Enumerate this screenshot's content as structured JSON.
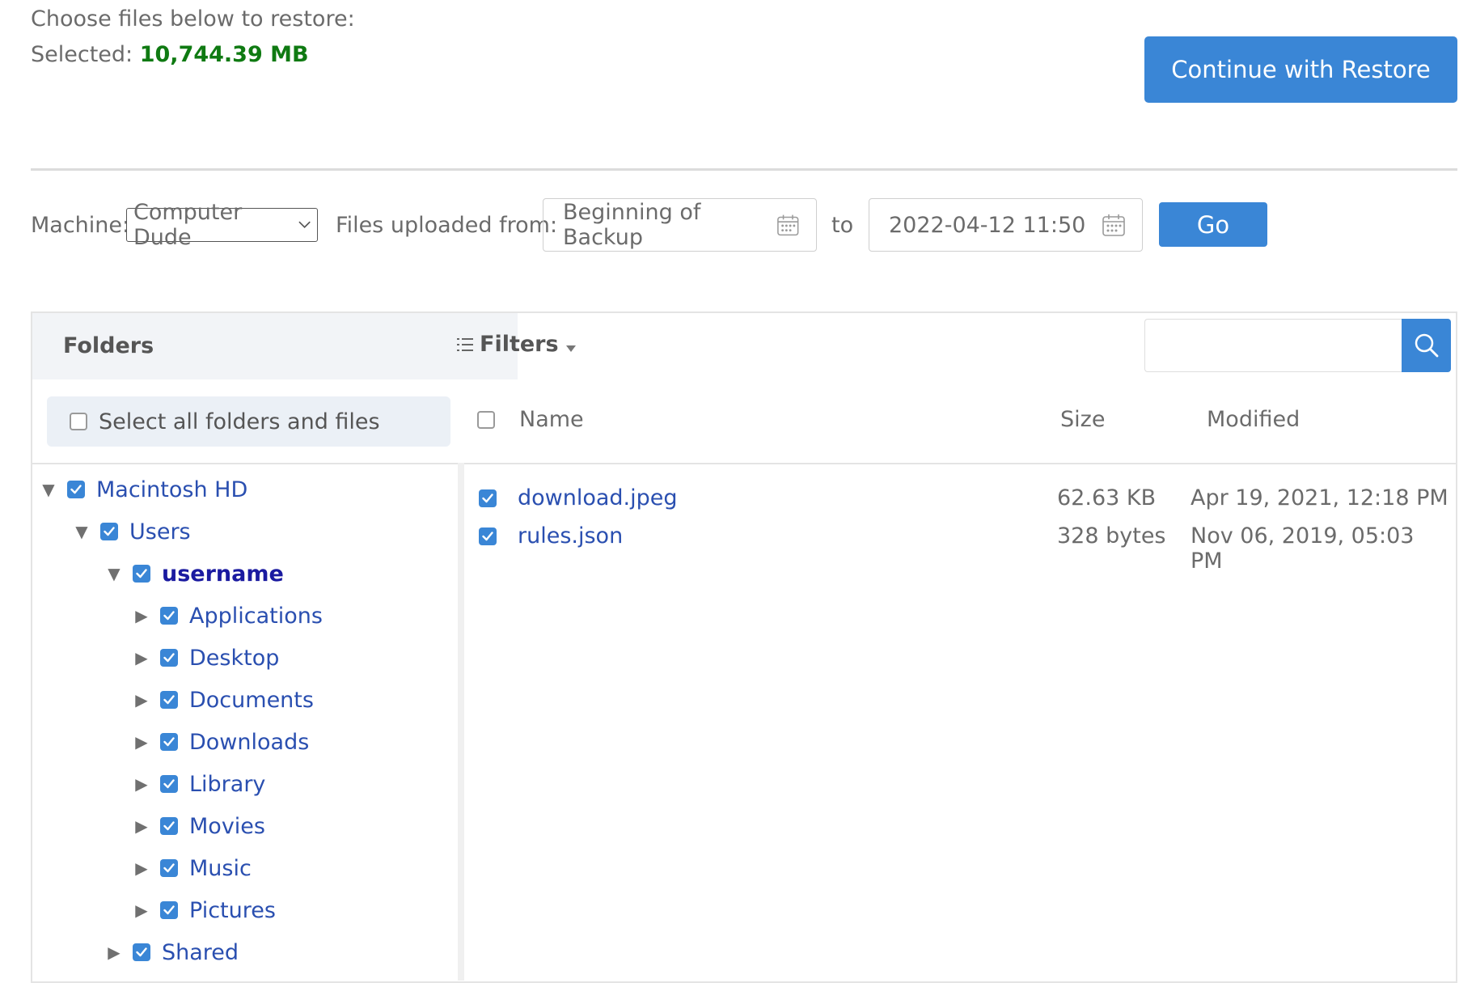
{
  "header": {
    "prompt": "Choose files below to restore:",
    "selected_label": "Selected:",
    "selected_value": "10,744.39 MB",
    "continue_label": "Continue with Restore"
  },
  "filter_bar": {
    "machine_label": "Machine:",
    "machine_value": "Computer Dude",
    "from_label": "Files uploaded from:",
    "from_value": "Beginning of Backup",
    "to_label": "to",
    "to_value": "2022-04-12 11:50",
    "go_label": "Go"
  },
  "panel": {
    "folders_title": "Folders",
    "filters_label": "Filters",
    "search_placeholder": "",
    "select_all_label": "Select all folders and files",
    "columns": {
      "name": "Name",
      "size": "Size",
      "modified": "Modified"
    }
  },
  "tree": [
    {
      "label": "Macintosh HD",
      "expanded": true,
      "checked": true,
      "level": 0
    },
    {
      "label": "Users",
      "expanded": true,
      "checked": true,
      "level": 1
    },
    {
      "label": "username",
      "expanded": true,
      "checked": true,
      "level": 2,
      "bold": true
    },
    {
      "label": "Applications",
      "expanded": false,
      "checked": true,
      "level": 3
    },
    {
      "label": "Desktop",
      "expanded": false,
      "checked": true,
      "level": 3
    },
    {
      "label": "Documents",
      "expanded": false,
      "checked": true,
      "level": 3
    },
    {
      "label": "Downloads",
      "expanded": false,
      "checked": true,
      "level": 3
    },
    {
      "label": "Library",
      "expanded": false,
      "checked": true,
      "level": 3
    },
    {
      "label": "Movies",
      "expanded": false,
      "checked": true,
      "level": 3
    },
    {
      "label": "Music",
      "expanded": false,
      "checked": true,
      "level": 3
    },
    {
      "label": "Pictures",
      "expanded": false,
      "checked": true,
      "level": 3
    },
    {
      "label": "Shared",
      "expanded": false,
      "checked": true,
      "level": 2
    }
  ],
  "files": [
    {
      "name": "download.jpeg",
      "size": "62.63 KB",
      "modified": "Apr 19, 2021, 12:18 PM",
      "checked": true
    },
    {
      "name": "rules.json",
      "size": "328 bytes",
      "modified": "Nov 06, 2019, 05:03 PM",
      "checked": true
    }
  ],
  "colors": {
    "accent": "#3a86d6",
    "selected_green": "#0f7a12",
    "link_blue": "#2a4fb0"
  }
}
